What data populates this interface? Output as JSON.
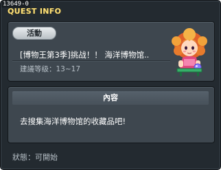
{
  "window": {
    "quest_id": "13649-0",
    "title": "QUEST INFO"
  },
  "quest": {
    "tag": "活動",
    "name": "[博物王第3季]挑战！！ 海洋博物馆..",
    "level_label": "建議等级：13~17",
    "npc_icon": "npc-girl-portrait"
  },
  "content": {
    "header": "內容",
    "description": "去搜集海洋博物馆的收藏品吧!"
  },
  "footer": {
    "status": "狀態：可開始"
  },
  "colors": {
    "window_bg": "#232a30",
    "panel_bg": "#3e474f",
    "title": "#ffe27a",
    "text": "#ffffff",
    "subtext": "#b7c0c7"
  }
}
